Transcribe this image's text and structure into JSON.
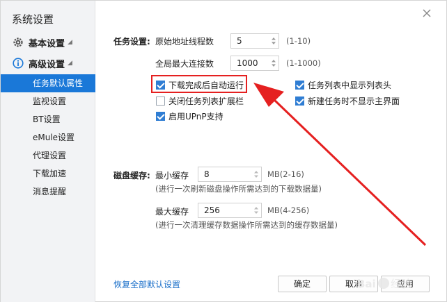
{
  "app_title": "系统设置",
  "sidebar": {
    "basic_group": "基本设置",
    "advanced_group": "高级设置",
    "items": [
      {
        "label": "任务默认属性",
        "active": true
      },
      {
        "label": "监视设置"
      },
      {
        "label": "BT设置"
      },
      {
        "label": "eMule设置"
      },
      {
        "label": "代理设置"
      },
      {
        "label": "下载加速"
      },
      {
        "label": "消息提醒"
      }
    ]
  },
  "task": {
    "section_label": "任务设置:",
    "origin_threads_label": "原始地址线程数",
    "origin_threads_value": "5",
    "origin_threads_range": "(1-10)",
    "max_conn_label": "全局最大连接数",
    "max_conn_value": "1000",
    "max_conn_range": "(1-1000)"
  },
  "checkboxes": {
    "auto_run": "下载完成后自动运行",
    "close_ext": "关闭任务列表扩展栏",
    "upnp": "启用UPnP支持",
    "show_header": "任务列表中显示列表头",
    "no_main_window": "新建任务时不显示主界面"
  },
  "disk": {
    "section_label": "磁盘缓存:",
    "min_label": "最小缓存",
    "min_value": "8",
    "min_unit": "MB(2-16)",
    "min_hint": "(进行一次刷新磁盘操作所需达到的下载数据量)",
    "max_label": "最大缓存",
    "max_value": "256",
    "max_unit": "MB(4-256)",
    "max_hint": "(进行一次清理缓存数据操作所需达到的缓存数据量)"
  },
  "footer": {
    "restore_link": "恢复全部默认设置",
    "ok": "确定",
    "cancel": "取消",
    "apply": "应用"
  },
  "colors": {
    "accent": "#1a78d8",
    "annotation": "#e52020"
  }
}
